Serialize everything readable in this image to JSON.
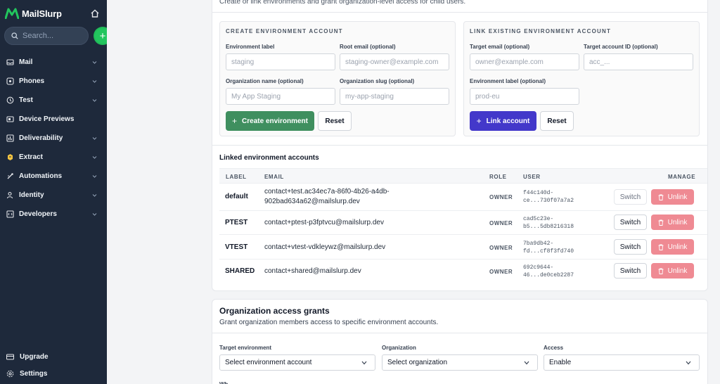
{
  "app": {
    "brand": "MailSlurp",
    "search_placeholder": "Search...",
    "add_symbol": "+"
  },
  "sidebar": {
    "items": [
      {
        "label": "Mail",
        "icon": "mail-icon"
      },
      {
        "label": "Phones",
        "icon": "phone-icon"
      },
      {
        "label": "Test",
        "icon": "test-icon"
      },
      {
        "label": "Device Previews",
        "icon": "device-icon"
      },
      {
        "label": "Deliverability",
        "icon": "chart-icon"
      },
      {
        "label": "Extract",
        "icon": "extract-icon"
      },
      {
        "label": "Automations",
        "icon": "automation-icon"
      },
      {
        "label": "Identity",
        "icon": "identity-icon"
      },
      {
        "label": "Developers",
        "icon": "code-icon"
      }
    ],
    "upgrade": "Upgrade",
    "settings": "Settings"
  },
  "page": {
    "description": "Create or link environments and grant organization-level access for child users."
  },
  "create_env": {
    "title": "CREATE ENVIRONMENT ACCOUNT",
    "env_label": "Environment label",
    "env_label_placeholder": "staging",
    "root_email": "Root email (optional)",
    "root_email_placeholder": "staging-owner@example.com",
    "org_name": "Organization name (optional)",
    "org_name_placeholder": "My App Staging",
    "org_slug": "Organization slug (optional)",
    "org_slug_placeholder": "my-app-staging",
    "create_button": "Create environment",
    "reset_button": "Reset"
  },
  "link_env": {
    "title": "LINK EXISTING ENVIRONMENT ACCOUNT",
    "target_email": "Target email (optional)",
    "target_email_placeholder": "owner@example.com",
    "target_id": "Target account ID (optional)",
    "target_id_placeholder": "acc_...",
    "env_label": "Environment label (optional)",
    "env_label_placeholder": "prod-eu",
    "link_button": "Link account",
    "reset_button": "Reset"
  },
  "linked": {
    "title": "Linked environment accounts",
    "columns": {
      "label": "LABEL",
      "email": "EMAIL",
      "role": "ROLE",
      "user": "USER",
      "manage": "MANAGE"
    },
    "rows": [
      {
        "label": "default",
        "email": "contact+test.ac34ec7a-86f0-4b26-a4db-902bad634a62@mailslurp.dev",
        "role": "OWNER",
        "user1": "f44c140d-",
        "user2": "ce...730f07a7a2",
        "switch": "Switch",
        "unlink": "Unlink"
      },
      {
        "label": "PTEST",
        "email": "contact+ptest-p3fptvcu@mailslurp.dev",
        "role": "OWNER",
        "user1": "cad5c23e-",
        "user2": "b5...5db8216318",
        "switch": "Switch",
        "unlink": "Unlink"
      },
      {
        "label": "VTEST",
        "email": "contact+vtest-vdkleywz@mailslurp.dev",
        "role": "OWNER",
        "user1": "7ba9db42-",
        "user2": "fd...cf8f3fd740",
        "switch": "Switch",
        "unlink": "Unlink"
      },
      {
        "label": "SHARED",
        "email": "contact+shared@mailslurp.dev",
        "role": "OWNER",
        "user1": "692c9644-",
        "user2": "46...de0ceb2287",
        "switch": "Switch",
        "unlink": "Unlink"
      }
    ]
  },
  "grants": {
    "title": "Organization access grants",
    "description": "Grant organization members access to specific environment accounts.",
    "target_env_label": "Target environment",
    "target_env_value": "Select environment account",
    "org_label": "Organization",
    "org_value": "Select organization",
    "access_label": "Access",
    "access_value": "Enable",
    "cut_label": "Wh"
  },
  "colors": {
    "sidebar_bg": "#1e293b",
    "accent_green": "#3f8f5f",
    "accent_blue": "#4338ca",
    "danger": "#ef8a93"
  }
}
